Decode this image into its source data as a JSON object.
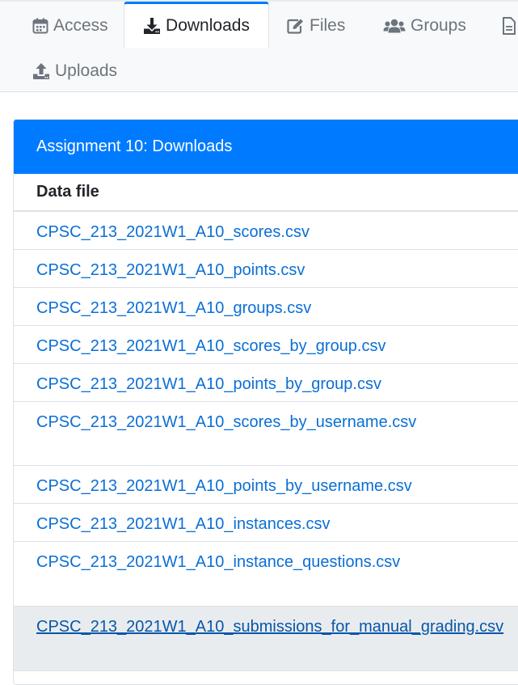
{
  "nav": {
    "tabs": [
      {
        "label": "Access",
        "icon": "calendar-icon"
      },
      {
        "label": "Downloads",
        "icon": "download-icon",
        "active": true
      },
      {
        "label": "Files",
        "icon": "edit-icon"
      },
      {
        "label": "Groups",
        "icon": "users-icon"
      },
      {
        "label": "",
        "icon": "file-icon"
      },
      {
        "label": "Uploads",
        "icon": "upload-icon"
      }
    ]
  },
  "card": {
    "title": "Assignment 10: Downloads",
    "column_header": "Data file",
    "files": [
      "CPSC_213_2021W1_A10_scores.csv",
      "CPSC_213_2021W1_A10_points.csv",
      "CPSC_213_2021W1_A10_groups.csv",
      "CPSC_213_2021W1_A10_scores_by_group.csv",
      "CPSC_213_2021W1_A10_points_by_group.csv",
      "CPSC_213_2021W1_A10_scores_by_username.csv",
      "CPSC_213_2021W1_A10_points_by_username.csv",
      "CPSC_213_2021W1_A10_instances.csv",
      "CPSC_213_2021W1_A10_instance_questions.csv",
      "CPSC_213_2021W1_A10_submissions_for_manual_grading.csv"
    ]
  },
  "colors": {
    "accent": "#007bff",
    "link": "#0a6fd6",
    "nav_background": "#f8f9fa",
    "hover_row": "#e9ecef"
  }
}
